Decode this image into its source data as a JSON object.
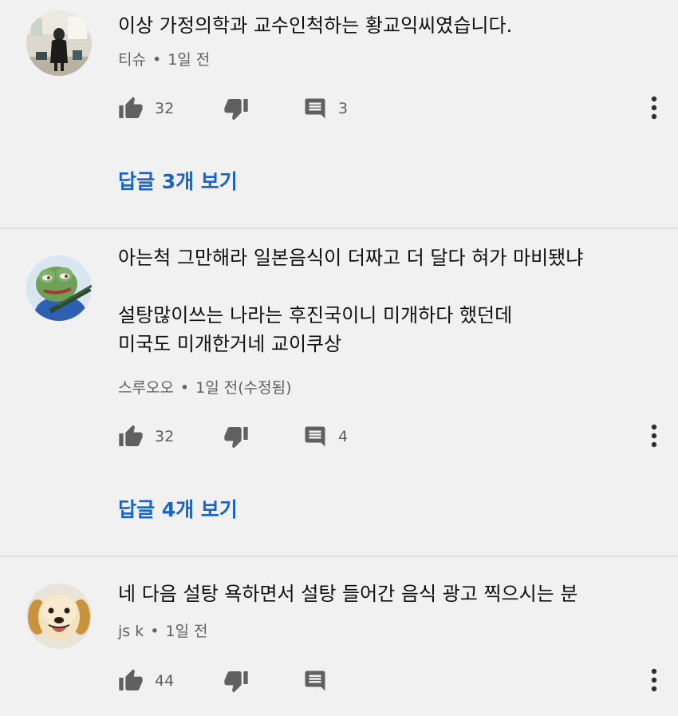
{
  "comments": [
    {
      "lines": [
        "이상 가정의학과 교수인척하는 황교익씨였습니다."
      ],
      "author": "티슈",
      "time": "1일 전",
      "likes": "32",
      "replies_count": "3",
      "view_replies": "답글 3개 보기"
    },
    {
      "lines": [
        "아는척 그만해라 일본음식이 더짜고 더 달다 혀가 마비됐냐",
        "",
        "설탕많이쓰는 나라는 후진국이니 미개하다 했던데",
        "미국도 미개한거네 교이쿠상"
      ],
      "author": "스루오오",
      "time": "1일 전(수정됨)",
      "likes": "32",
      "replies_count": "4",
      "view_replies": "답글 4개 보기"
    },
    {
      "lines": [
        "네 다음 설탕 욕하면서 설탕 들어간 음식 광고 찍으시는 분"
      ],
      "author": "js k",
      "time": "1일 전",
      "likes": "44",
      "replies_count": ""
    }
  ],
  "separator": "•",
  "icons": {
    "like": "thumb-up-icon",
    "dislike": "thumb-down-icon",
    "reply": "comment-icon",
    "more": "more-vert-icon"
  },
  "colors": {
    "background": "#f1f1f1",
    "link": "#1a64c7",
    "secondary_text": "#606060",
    "icon": "#606060"
  }
}
